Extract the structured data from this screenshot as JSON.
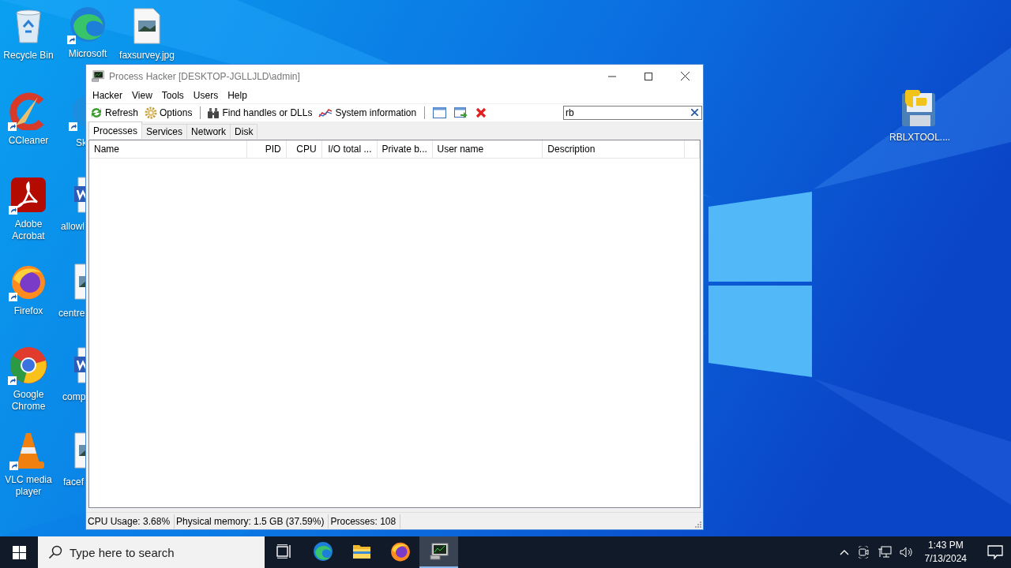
{
  "desktop_icons": [
    {
      "kind": "recycle_bin",
      "label": "Recycle Bin"
    },
    {
      "kind": "edge",
      "label": "Microsoft"
    },
    {
      "kind": "image_file",
      "label": "faxsurvey.jpg"
    },
    {
      "kind": "ccleaner",
      "label": "CCleaner"
    },
    {
      "kind": "skype",
      "label": "Sk"
    },
    {
      "kind": "acrobat",
      "label": "Adobe Acrobat"
    },
    {
      "kind": "word_file",
      "label": "allowl"
    },
    {
      "kind": "firefox",
      "label": "Firefox"
    },
    {
      "kind": "image_file",
      "label": "centre"
    },
    {
      "kind": "chrome",
      "label": "Google Chrome"
    },
    {
      "kind": "word_file",
      "label": "comp"
    },
    {
      "kind": "vlc",
      "label": "VLC media player"
    },
    {
      "kind": "image_file",
      "label": "facef"
    },
    {
      "kind": "python_file",
      "label": "RBLXTOOL...."
    }
  ],
  "window": {
    "title": "Process Hacker [DESKTOP-JGLLJLD\\admin]",
    "menu": [
      "Hacker",
      "View",
      "Tools",
      "Users",
      "Help"
    ],
    "toolbar": [
      {
        "kind": "refresh",
        "label": "Refresh"
      },
      {
        "kind": "options",
        "label": "Options"
      },
      {
        "kind": "separator"
      },
      {
        "kind": "find",
        "label": "Find handles or DLLs"
      },
      {
        "kind": "sysinfo",
        "label": "System information"
      },
      {
        "kind": "separator"
      },
      {
        "kind": "window"
      },
      {
        "kind": "window_go"
      },
      {
        "kind": "delete"
      }
    ],
    "filter": {
      "value": "rb"
    },
    "tabs": [
      {
        "label": "Processes",
        "selected": true
      },
      {
        "label": "Services",
        "selected": false
      },
      {
        "label": "Network",
        "selected": false
      },
      {
        "label": "Disk",
        "selected": false
      }
    ],
    "columns": [
      "Name",
      "PID",
      "CPU",
      "I/O total ...",
      "Private b...",
      "User name",
      "Description"
    ],
    "status": [
      "CPU Usage: 3.68%",
      "Physical memory: 1.5 GB (37.59%)",
      "Processes: 108"
    ]
  },
  "taskbar": {
    "search": {
      "placeholder": "Type here to search"
    },
    "apps": [
      {
        "kind": "task_view",
        "selected": false
      },
      {
        "kind": "edge",
        "selected": false
      },
      {
        "kind": "explorer",
        "selected": false
      },
      {
        "kind": "firefox",
        "selected": false
      },
      {
        "kind": "process_hacker",
        "selected": true
      }
    ],
    "clock": {
      "time": "1:43 PM",
      "date": "7/13/2024"
    }
  }
}
